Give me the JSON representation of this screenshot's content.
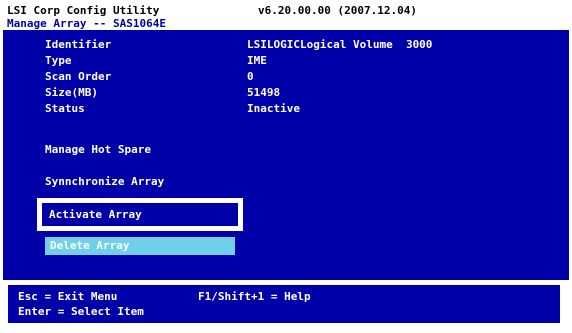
{
  "header": {
    "app_title": "LSI Corp Config Utility",
    "version": "v6.20.00.00 (2007.12.04)",
    "screen_title": "Manage Array -- SAS1064E"
  },
  "details": [
    {
      "label": "Identifier",
      "value": "LSILOGICLogical Volume  3000"
    },
    {
      "label": "Type",
      "value": "IME"
    },
    {
      "label": "Scan Order",
      "value": "0"
    },
    {
      "label": "Size(MB)",
      "value": "51498"
    },
    {
      "label": "Status",
      "value": "Inactive"
    }
  ],
  "menu": {
    "manage_hot_spare": "Manage Hot Spare",
    "synchronize_array": "Synnchronize Array",
    "activate_array": "Activate Array",
    "delete_array": "Delete Array"
  },
  "footer": {
    "esc_hint": "Esc = Exit Menu",
    "help_hint": "F1/Shift+1 = Help",
    "enter_hint": "Enter = Select Item"
  },
  "colors": {
    "background": "#0000a8",
    "frame": "#ffffff",
    "highlight": "#70d0e8"
  }
}
